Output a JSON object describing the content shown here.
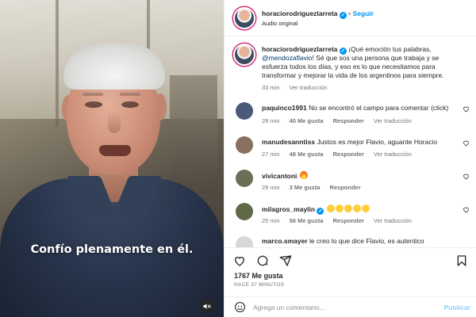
{
  "video": {
    "caption": "Confío plenamente en él.",
    "mute_icon": "speaker-muted-icon"
  },
  "post": {
    "author": "horaciorodriguezlarreta",
    "verified": true,
    "follow_label": "Seguir",
    "audio_label": "Audio original"
  },
  "main_comment": {
    "author": "horaciorodriguezlarreta",
    "line1": "¡Qué emoción tus palabras,",
    "mention": "@mendozaflavio",
    "line2_rest": "! Sé que sos una persona que trabaja y se",
    "line3": "esfuerza todos los días, y eso es lo que necesitamos para",
    "line4": "transformar y mejorar la vida de los argentinos para siempre.",
    "time": "33 min",
    "reply_link": "Ver traducción"
  },
  "comments": [
    {
      "user": "paquinco1991",
      "text": "No se encontró el campo para comentar (click)",
      "time": "28 min",
      "likes": "40 Me gusta",
      "reply": "Responder",
      "translate": "Ver traducción",
      "avatar_color": "#4a5a78"
    },
    {
      "user": "manudesanntiss",
      "text": "Justos es mejor Flavio, aguante Horacio",
      "time": "27 min",
      "likes": "48 Me gusta",
      "reply": "Responder",
      "translate": "Ver traducción",
      "avatar_color": "#8a7060"
    },
    {
      "user": "vivicantoni",
      "text": "",
      "emoji": "fire",
      "time": "29 min",
      "likes": "3 Me gusta",
      "reply": "Responder",
      "avatar_color": "#6a6f55"
    },
    {
      "user": "milagros_maylin",
      "verified": true,
      "text": "",
      "emoji_count": 5,
      "emoji": "scream",
      "time": "25 min",
      "likes": "56 Me gusta",
      "reply": "Responder",
      "translate": "Ver traducción",
      "avatar_color": "#5e6a45"
    },
    {
      "user": "marco.smayer",
      "text": "le creo lo que dice Flavio, es autentico",
      "avatar_color": "#b0b0b0"
    }
  ],
  "actions": {
    "like_icon": "heart-icon",
    "comment_icon": "comment-icon",
    "share_icon": "share-icon",
    "save_icon": "bookmark-icon"
  },
  "likes_count": "1767 Me gusta",
  "posted_ago": "HACE 37 MINUTOS",
  "composer": {
    "emoji_icon": "smiley-icon",
    "placeholder": "Agrega un comentario...",
    "publish_label": "Publicar"
  },
  "colors": {
    "accent": "#0095f6",
    "text": "#262626",
    "muted": "#737373",
    "ring": "#d62976"
  }
}
